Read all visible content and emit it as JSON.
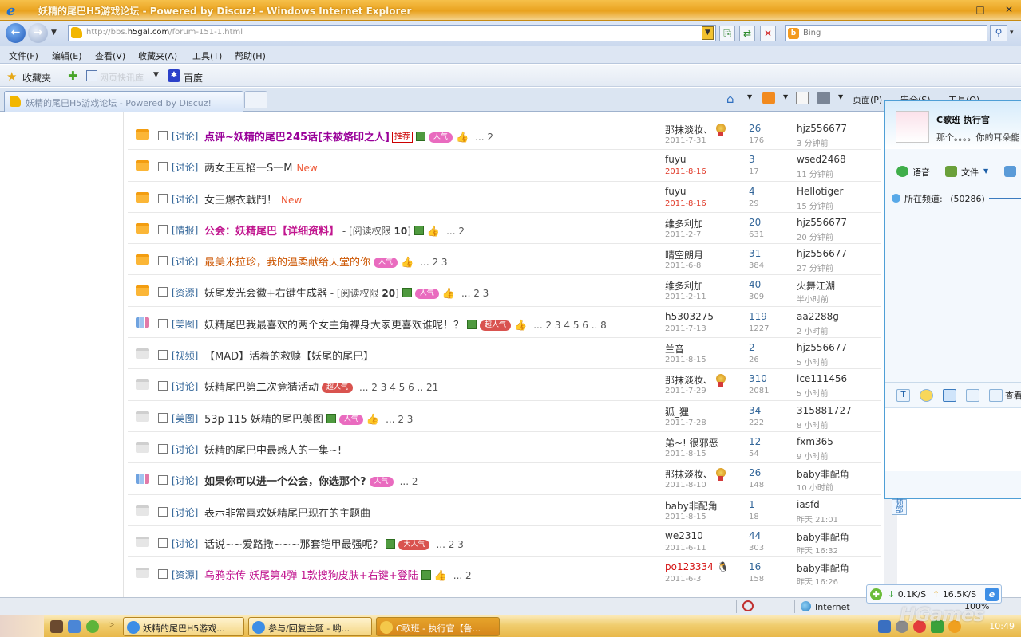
{
  "window": {
    "title": "妖精的尾巴H5游戏论坛 - Powered by Discuz! - Windows Internet Explorer",
    "minimize": "—",
    "maximize": "□",
    "close": "✕"
  },
  "address_bar": {
    "url_prefix": "http://bbs.",
    "url_domain": "h5gal.com",
    "url_suffix": "/forum-151-1.html",
    "search_placeholder": "Bing"
  },
  "menu": [
    "文件(F)",
    "编辑(E)",
    "查看(V)",
    "收藏夹(A)",
    "工具(T)",
    "帮助(H)"
  ],
  "favorites_bar": {
    "favorites_label": "收藏夹",
    "baidu_label": "百度",
    "faded_item": "网页快讯库"
  },
  "tab": {
    "title": "妖精的尾巴H5游戏论坛 - Powered by Discuz!"
  },
  "command_bar": {
    "page": "页面(P)",
    "safety": "安全(S)",
    "tools": "工具(O)"
  },
  "threads": [
    {
      "icon": "folder",
      "category": "[讨论]",
      "subject": "点评~妖精的尾巴245话[未被烙印之人]",
      "style": "purple",
      "recommend": "推荐",
      "image": true,
      "hot": "人气",
      "thumb": true,
      "pages": "... 2",
      "author": "那抹淡妆、",
      "date": "2011-7-31",
      "medal": true,
      "replies": "26",
      "views": "176",
      "last_user": "hjz556677",
      "last_time": "3 分钟前"
    },
    {
      "icon": "folder",
      "category": "[讨论]",
      "subject": "两女王互掐一S一M",
      "new": "New",
      "author": "fuyu",
      "date": "2011-8-16",
      "date_red": true,
      "replies": "3",
      "views": "17",
      "last_user": "wsed2468",
      "last_time": "11 分钟前"
    },
    {
      "icon": "folder",
      "category": "[讨论]",
      "subject": "女王爆衣戰鬥！",
      "new": "New",
      "author": "fuyu",
      "date": "2011-8-16",
      "date_red": true,
      "replies": "4",
      "views": "29",
      "last_user": "Hellotiger",
      "last_time": "15 分钟前"
    },
    {
      "icon": "folder",
      "category": "[情报]",
      "subject": "公会：妖精尾巴【详细资料】",
      "style": "magenta",
      "perm_prefix": " - [阅读权限 ",
      "perm_value": "10",
      "perm_suffix": "]",
      "image": true,
      "thumb": true,
      "pages": "... 2",
      "author": "维多利加",
      "date": "2011-2-7",
      "replies": "20",
      "views": "631",
      "last_user": "hjz556677",
      "last_time": "20 分钟前"
    },
    {
      "icon": "folder",
      "category": "[讨论]",
      "subject": "最美米拉珍，我的温柔献给天堂的你",
      "style": "orange",
      "hot": "人气",
      "thumb": true,
      "pages": "... 2  3",
      "author": "晴空朗月",
      "date": "2011-6-8",
      "replies": "31",
      "views": "384",
      "last_user": "hjz556677",
      "last_time": "27 分钟前"
    },
    {
      "icon": "folder",
      "category": "[资源]",
      "subject": "妖尾发光会徽+右键生成器",
      "perm_prefix": " - [阅读权限 ",
      "perm_value": "20",
      "perm_suffix": "]",
      "image": true,
      "hot": "人气",
      "thumb": true,
      "pages": "... 2  3",
      "author": "维多利加",
      "date": "2011-2-11",
      "replies": "40",
      "views": "309",
      "last_user": "火舞江湖",
      "last_time": "半小时前"
    },
    {
      "icon": "poll",
      "category": "[美图]",
      "subject": "妖精尾巴我最喜欢的两个女主角裸身大家更喜欢谁呢！？",
      "image": true,
      "hot_red": "超人气",
      "thumb": true,
      "pages": "... 2  3  4  5  6 .. 8",
      "author": "h5303275",
      "date": "2011-7-13",
      "replies": "119",
      "views": "1227",
      "last_user": "aa2288g",
      "last_time": "2 小时前"
    },
    {
      "icon": "gray",
      "category": "[视频]",
      "subject": "【MAD】活着的救赎【妖尾的尾巴】",
      "author": "兰音",
      "date": "2011-8-15",
      "replies": "2",
      "views": "26",
      "last_user": "hjz556677",
      "last_time": "5 小时前"
    },
    {
      "icon": "gray",
      "category": "[讨论]",
      "subject": "妖精尾巴第二次竞猜活动",
      "hot_red": "超人气",
      "pages": "... 2  3  4  5  6 .. 21",
      "author": "那抹淡妆、",
      "date": "2011-7-29",
      "medal": true,
      "replies": "310",
      "views": "2081",
      "last_user": "ice111456",
      "last_time": "5 小时前"
    },
    {
      "icon": "gray",
      "category": "[美图]",
      "subject": "53p 115 妖精的尾巴美图",
      "image": true,
      "hot": "人气",
      "thumb": true,
      "pages": "... 2  3",
      "author": "狐_狸",
      "date": "2011-7-28",
      "replies": "34",
      "views": "222",
      "last_user": "315881727",
      "last_time": "8 小时前"
    },
    {
      "icon": "gray",
      "category": "[讨论]",
      "subject": "妖精的尾巴中最感人的一集~!",
      "author": "弟~! 很邪恶",
      "date": "2011-8-15",
      "replies": "12",
      "views": "54",
      "last_user": "fxm365",
      "last_time": "9 小时前"
    },
    {
      "icon": "poll",
      "category": "[讨论]",
      "subject": "如果你可以进一个公会，你选那个?",
      "style": "bold",
      "hot": "人气",
      "pages": "... 2",
      "author": "那抹淡妆、",
      "date": "2011-8-10",
      "medal": true,
      "replies": "26",
      "views": "148",
      "last_user": "baby非配角",
      "last_time": "10 小时前"
    },
    {
      "icon": "gray",
      "category": "[讨论]",
      "subject": "表示非常喜欢妖精尾巴现在的主题曲",
      "author": "baby非配角",
      "date": "2011-8-15",
      "replies": "1",
      "views": "18",
      "last_user": "iasfd",
      "last_time": "昨天 21:01"
    },
    {
      "icon": "gray",
      "category": "[讨论]",
      "subject": "话说~~爱路撒~~~那套铠甲最强呢？",
      "image": true,
      "hot_red": "大人气",
      "pages": "... 2  3",
      "author": "we2310",
      "date": "2011-6-11",
      "replies": "44",
      "views": "303",
      "last_user": "baby非配角",
      "last_time": "昨天 16:32"
    },
    {
      "icon": "gray",
      "category": "[资源]",
      "subject": "乌鸦亲传 妖尾第4弹 1款搜狗皮肤+右键+登陆",
      "style": "pink",
      "image": true,
      "thumb": true,
      "pages": "... 2",
      "author": "po123334",
      "author_red": true,
      "date": "2011-6-3",
      "qq": true,
      "replies": "16",
      "views": "158",
      "last_user": "baby非配角",
      "last_time": "昨天 16:26"
    }
  ],
  "qq_chat": {
    "name": "C歌班    执行官",
    "signature": "那个。。。。你的耳朵能",
    "voice": "语音",
    "file": "文件",
    "channel_label": "所在频道:",
    "channel_id": "(50286)",
    "view": "查看",
    "side_tab": "频部"
  },
  "status_bar": {
    "zone": "Internet",
    "zoom": "100%"
  },
  "net_speed": {
    "down": "0.1K/S",
    "up": "16.5K/S"
  },
  "taskbar": {
    "tasks": [
      "妖精的尾巴H5游戏...",
      "参与/回复主题 - 哟...",
      "C歌班 - 执行官【鲁..."
    ],
    "clock": "10:49"
  },
  "watermark": "HGames"
}
